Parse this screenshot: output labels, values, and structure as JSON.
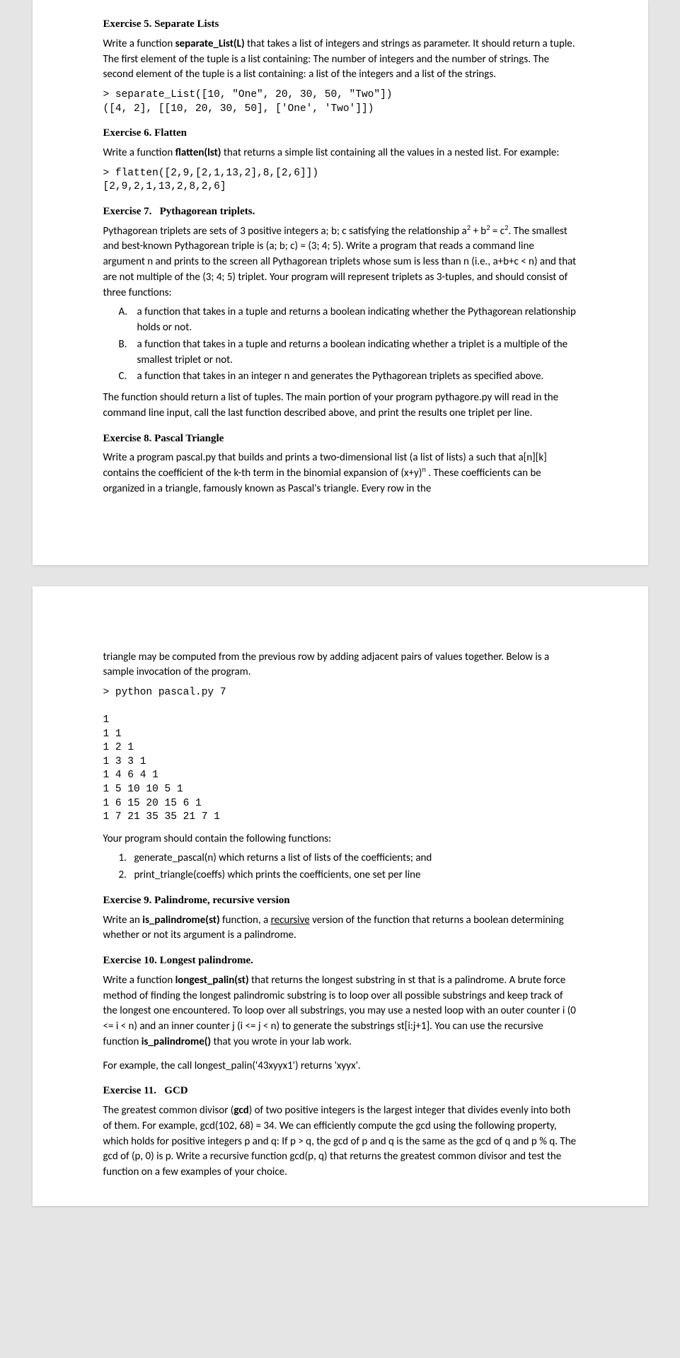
{
  "ex5": {
    "title_num": "Exercise 5.",
    "title_name": "Separate Lists",
    "p1_a": "Write a function ",
    "p1_bold": "separate_List(L)",
    "p1_b": " that takes a list of integers and strings as parameter. It should return a tuple. The first element of the tuple is a list containing: The number of integers and the number of strings. The second element of the tuple is a list containing: a list of the integers and a list of the strings.",
    "code": "> separate_List([10, \"One\", 20, 30, 50, \"Two\"])\n([4, 2], [[10, 20, 30, 50], ['One', 'Two']])"
  },
  "ex6": {
    "title_num": "Exercise 6.",
    "title_name": "Flatten",
    "p1_a": "Write a function ",
    "p1_bold": "flatten(lst)",
    "p1_b": " that returns a simple list containing all the values in a nested list. For example:",
    "code": "> flatten([2,9,[2,1,13,2],8,[2,6]])\n[2,9,2,1,13,2,8,2,6]"
  },
  "ex7": {
    "title_num": "Exercise 7.",
    "title_name": "Pythagorean triplets.",
    "p1_a": "Pythagorean triplets are sets of 3 positive integers a; b; c satisfying the relationship a",
    "p1_b": " + b",
    "p1_c": " = c",
    "p1_d": ". The smallest and best-known Pythagorean triple is (a; b; c) = (3; 4; 5). Write a program that reads a command line argument n and prints to the screen all Pythagorean triplets whose sum is less than n (i.e., a+b+c < n) and that are not multiple of the (3; 4; 5) triplet. Your program will represent triplets as 3-tuples, and should consist of three functions:",
    "sup2": "2",
    "li_a": "a function that takes in a tuple and returns a boolean indicating whether the Pythagorean relationship holds or not.",
    "li_b": "a function that takes in a tuple and returns a boolean indicating whether a triplet is a multiple of the smallest triplet or not.",
    "li_c": "a function that takes in an integer n and generates the Pythagorean triplets as specified above.",
    "p2": "The function should return a list of tuples. The main portion of your program pythagore.py will read in the command line input, call the last function described above, and print the results one triplet per line."
  },
  "ex8": {
    "title_num": "Exercise 8.",
    "title_name": "Pascal Triangle",
    "p1_a": "Write a program pascal.py that builds and prints a two-dimensional list (a list of lists) a such that a[n][k] contains the coefficient of the k-th term in the binomial expansion of (x+y)",
    "sup_n": "n",
    "p1_b": " . These coefficients can be organized in a triangle, famously known as Pascal's triangle. Every row in the",
    "p2": "triangle may be computed from the previous row by adding adjacent pairs of values together. Below is a sample invocation of the program.",
    "code": "> python pascal.py 7\n\n1\n1 1\n1 2 1\n1 3 3 1\n1 4 6 4 1\n1 5 10 10 5 1\n1 6 15 20 15 6 1\n1 7 21 35 35 21 7 1",
    "p3": "Your program should contain the following functions:",
    "li1_bold": "generate_pascal(n)",
    "li1_rest": " which returns a list of lists of the coefficients; and",
    "li2_bold": "print_triangle(coeffs)",
    "li2_rest": " which prints the coefficients, one set per line"
  },
  "ex9": {
    "title_num": "Exercise 9.",
    "title_name": "Palindrome, recursive version",
    "p1_a": "Write an ",
    "p1_bold": "is_palindrome(st)",
    "p1_b": " function, a ",
    "p1_under": "recursive",
    "p1_c": " version of the function that returns a boolean determining whether or not its argument is a palindrome."
  },
  "ex10": {
    "title_num": "Exercise 10.",
    "title_name": "Longest palindrome.",
    "p1_a": "Write a function ",
    "p1_bold": "longest_palin(st)",
    "p1_b": " that returns the longest substring in st that is a palindrome. A brute force method of finding the longest palindromic substring is to loop over all possible substrings and keep track of the longest one encountered. To loop over all substrings, you may use a nested loop with an outer counter i (0 <=  i < n) and an inner counter j (i <= j < n) to generate the substrings st[i:j+1].  You can use the recursive function ",
    "p1_bold2": "is_palindrome()",
    "p1_c": " that you wrote in your lab work.",
    "p2": "For example, the call longest_palin('43xyyx1') returns 'xyyx'."
  },
  "ex11": {
    "title_num": "Exercise 11.",
    "title_name": "GCD",
    "p1_a": "The greatest common divisor (",
    "p1_bold": "gcd",
    "p1_b": ") of two positive integers is the largest integer that divides evenly into both of them. For example, gcd(102, 68) = 34. We can efficiently compute the gcd using the following property, which holds for positive integers p and q: If p > q, the gcd of p and q is the same as the gcd of q and p % q. The gcd of (p, 0) is p. Write a recursive function gcd(p, q) that returns the greatest common divisor and test the function on a few examples of your choice."
  }
}
